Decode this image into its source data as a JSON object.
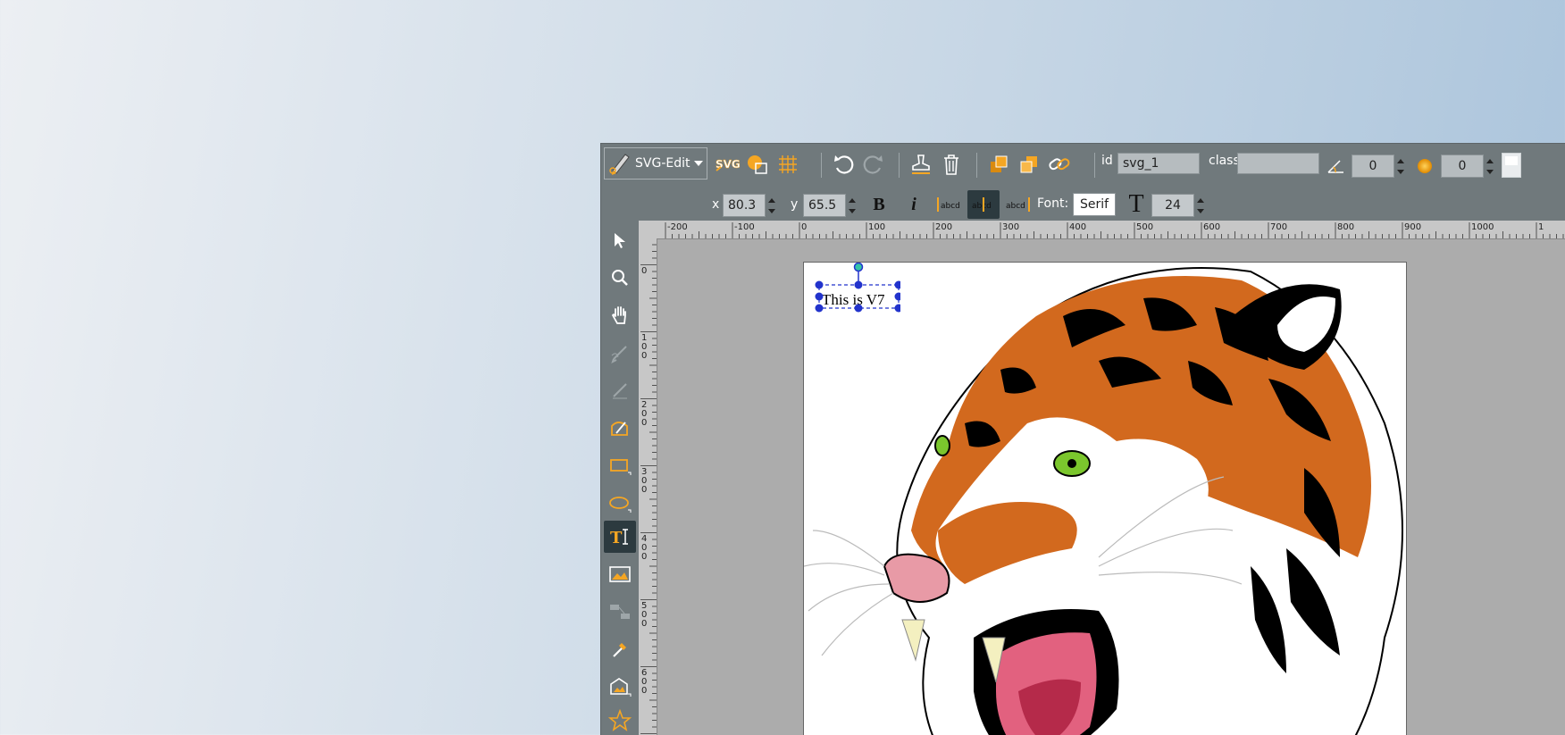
{
  "app": {
    "menu_label": "SVG-Edit"
  },
  "toolbar": {
    "id_label": "id",
    "id_value": "svg_1",
    "class_label": "class",
    "class_value": "",
    "angle_value": "0",
    "blur_value": "0"
  },
  "text_context": {
    "x_label": "x",
    "x_value": "80.3",
    "y_label": "y",
    "y_value": "65.5",
    "font_label": "Font:",
    "font_value": "Serif",
    "font_size_value": "24"
  },
  "ruler_h_labels": [
    "-200",
    "-100",
    "0",
    "100",
    "200",
    "300",
    "400",
    "500",
    "600",
    "700",
    "800",
    "900",
    "1000",
    "1"
  ],
  "ruler_v_labels": [
    "0",
    "100",
    "200",
    "300",
    "400",
    "500",
    "600"
  ],
  "canvas": {
    "selected_text": "This is V7"
  },
  "colors": {
    "accent": "#f5a623",
    "toolbar_bg": "#70797c",
    "selection": "#2233cc"
  }
}
